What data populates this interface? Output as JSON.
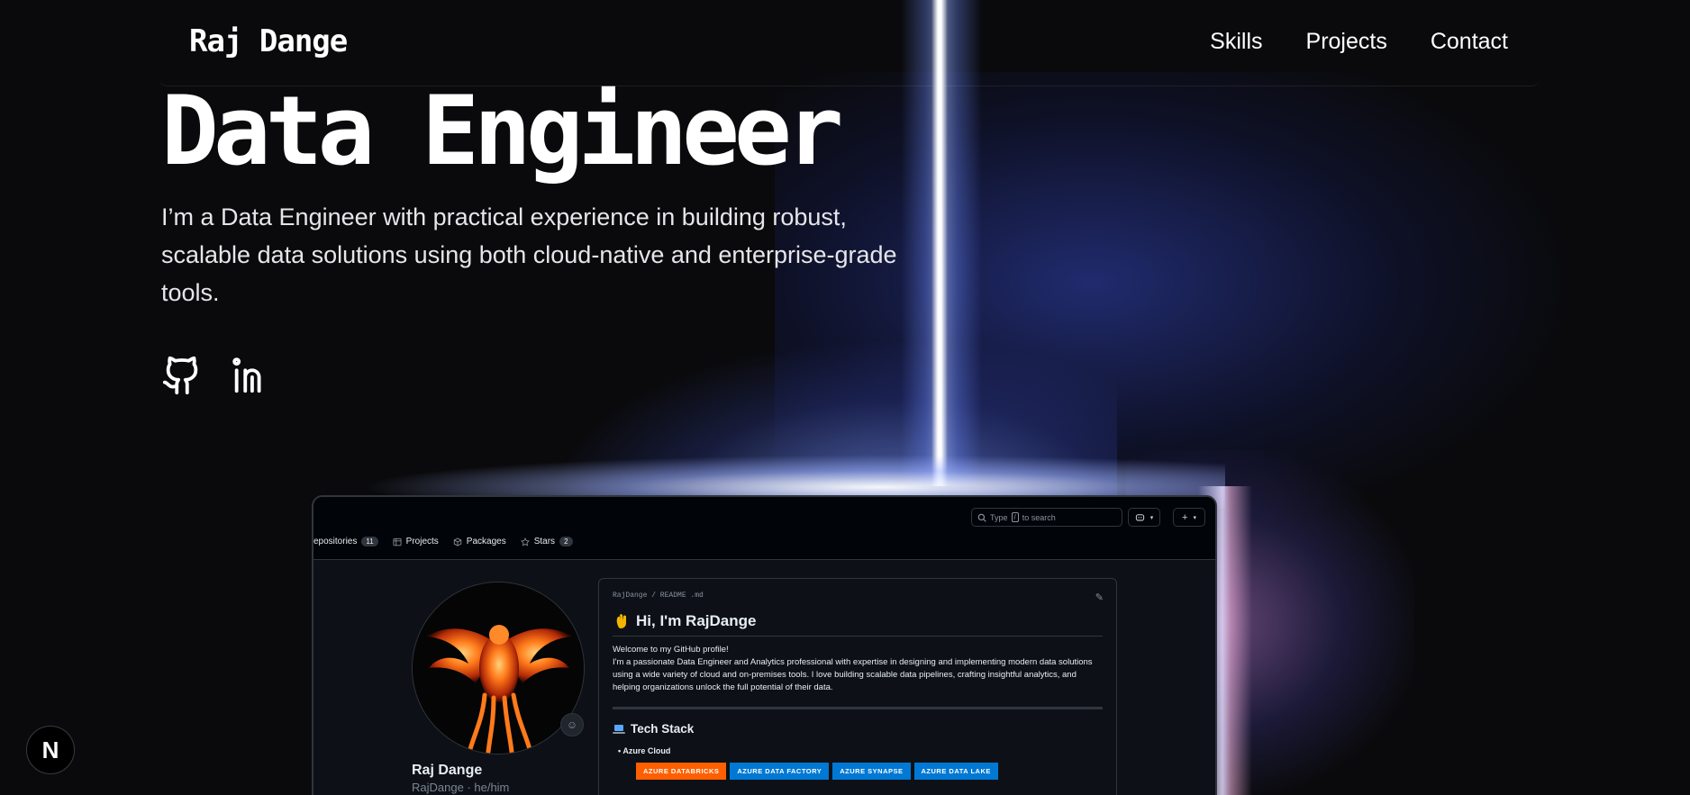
{
  "site": {
    "brand": "Raj Dange",
    "nav": [
      "Skills",
      "Projects",
      "Contact"
    ]
  },
  "hero": {
    "title": "Data Engineer",
    "description": "I’m a Data Engineer with practical experience in building robust, scalable data solutions using both cloud-native and enterprise-grade tools.",
    "social": [
      "github-icon",
      "linkedin-icon"
    ]
  },
  "next_badge": "N",
  "github_preview": {
    "search_pre": "Type",
    "search_key": "/",
    "search_post": "to search",
    "tabs": [
      {
        "label": "epositories",
        "count": "11",
        "icon": "repo-icon"
      },
      {
        "label": "Projects",
        "icon": "table-icon"
      },
      {
        "label": "Packages",
        "icon": "package-icon"
      },
      {
        "label": "Stars",
        "count": "2",
        "icon": "star-icon"
      }
    ],
    "profile": {
      "name": "Raj Dange",
      "login": "RajDange · he/him"
    },
    "readme": {
      "path": "RajDange / README .md",
      "heading": "Hi, I'm RajDange",
      "welcome": "Welcome to my GitHub profile!",
      "intro": "I'm a passionate Data Engineer and Analytics professional with expertise in designing and implementing modern data solutions using a wide variety of cloud and on-premises tools. I love building scalable data pipelines, crafting insightful analytics, and helping organizations unlock the full potential of their data.",
      "section": "Tech Stack",
      "list_item": "Azure Cloud",
      "badges": [
        {
          "label": "AZURE DATABRICKS",
          "color": "#ff5f00"
        },
        {
          "label": "AZURE DATA FACTORY",
          "color": "#0078d4"
        },
        {
          "label": "AZURE SYNAPSE",
          "color": "#0078d4"
        },
        {
          "label": "AZURE DATA LAKE",
          "color": "#0078d4"
        }
      ]
    }
  }
}
